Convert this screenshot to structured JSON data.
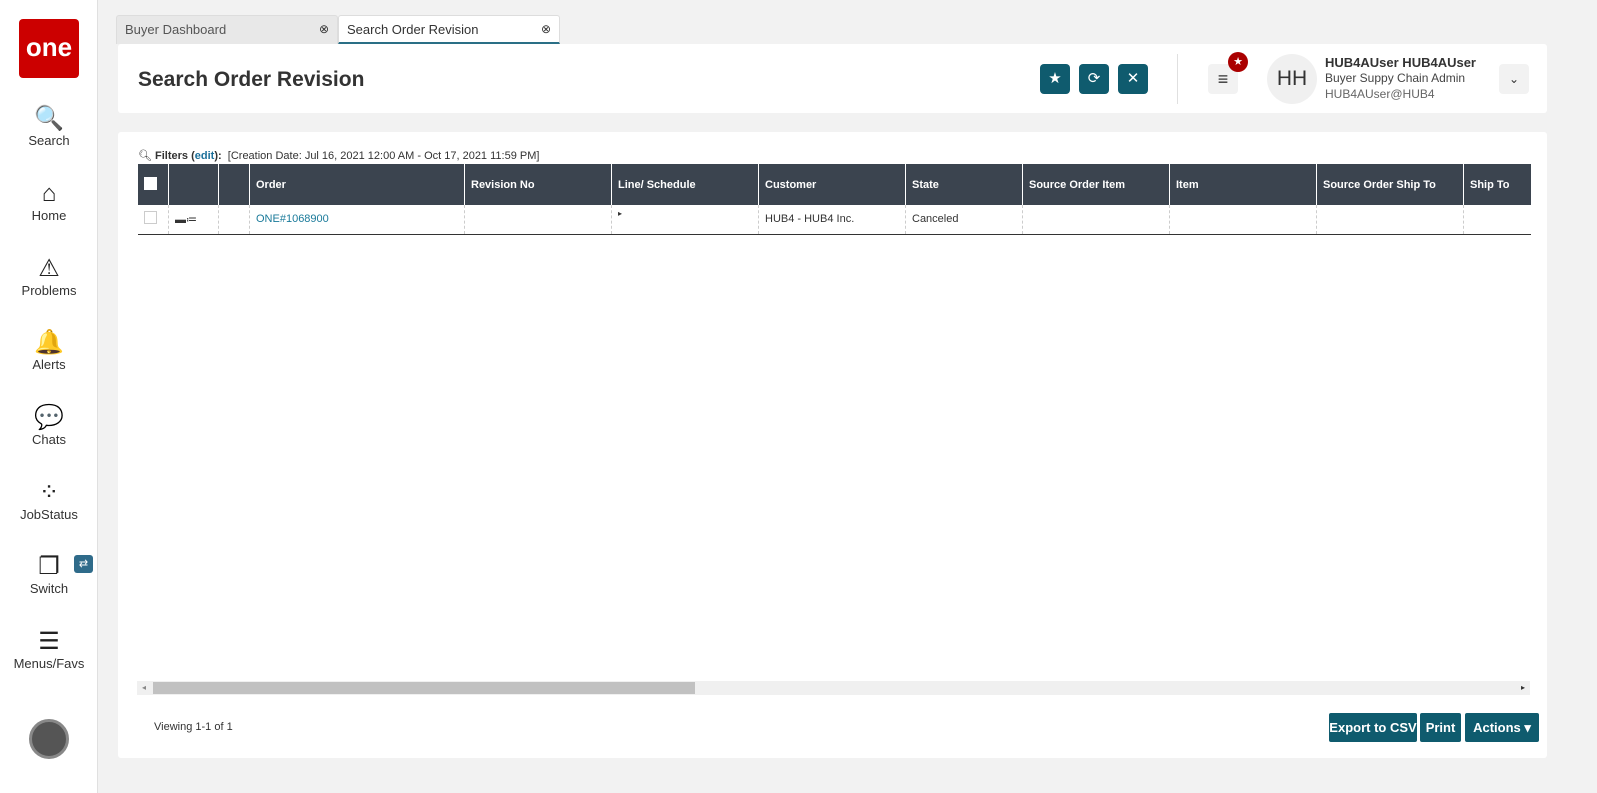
{
  "sidebar": {
    "logo": "one",
    "items": [
      {
        "label": "Search",
        "icon": "🔍"
      },
      {
        "label": "Home",
        "icon": "⌂"
      },
      {
        "label": "Problems",
        "icon": "⚠"
      },
      {
        "label": "Alerts",
        "icon": "🔔"
      },
      {
        "label": "Chats",
        "icon": "💬"
      },
      {
        "label": "JobStatus",
        "icon": "⁘"
      },
      {
        "label": "Switch",
        "icon": "❐"
      },
      {
        "label": "Menus/Favs",
        "icon": "☰"
      }
    ],
    "switch_badge": "⇄"
  },
  "tabs": [
    {
      "label": "Buyer Dashboard"
    },
    {
      "label": "Search Order Revision"
    }
  ],
  "header": {
    "title": "Search Order Revision",
    "user": {
      "initials": "HH",
      "name": "HUB4AUser HUB4AUser",
      "role": "Buyer Suppy Chain Admin",
      "email": "HUB4AUser@HUB4"
    }
  },
  "filters": {
    "label": "Filters (",
    "edit": "edit",
    "close": "):",
    "text": "[Creation Date: Jul 16, 2021 12:00 AM - Oct 17, 2021 11:59 PM]"
  },
  "table": {
    "columns": [
      "Order",
      "Revision No",
      "Line/ Schedule",
      "Customer",
      "State",
      "Source Order Item",
      "Item",
      "Source Order Ship To",
      "Ship To"
    ],
    "rows": [
      {
        "order": "ONE#1068900",
        "revision_no": "",
        "line": "▸",
        "customer": "HUB4 - HUB4 Inc.",
        "state": "Canceled"
      }
    ]
  },
  "footer": {
    "viewing": "Viewing 1-1 of 1",
    "export": "Export to CSV",
    "print": "Print",
    "actions": "Actions ▾"
  }
}
